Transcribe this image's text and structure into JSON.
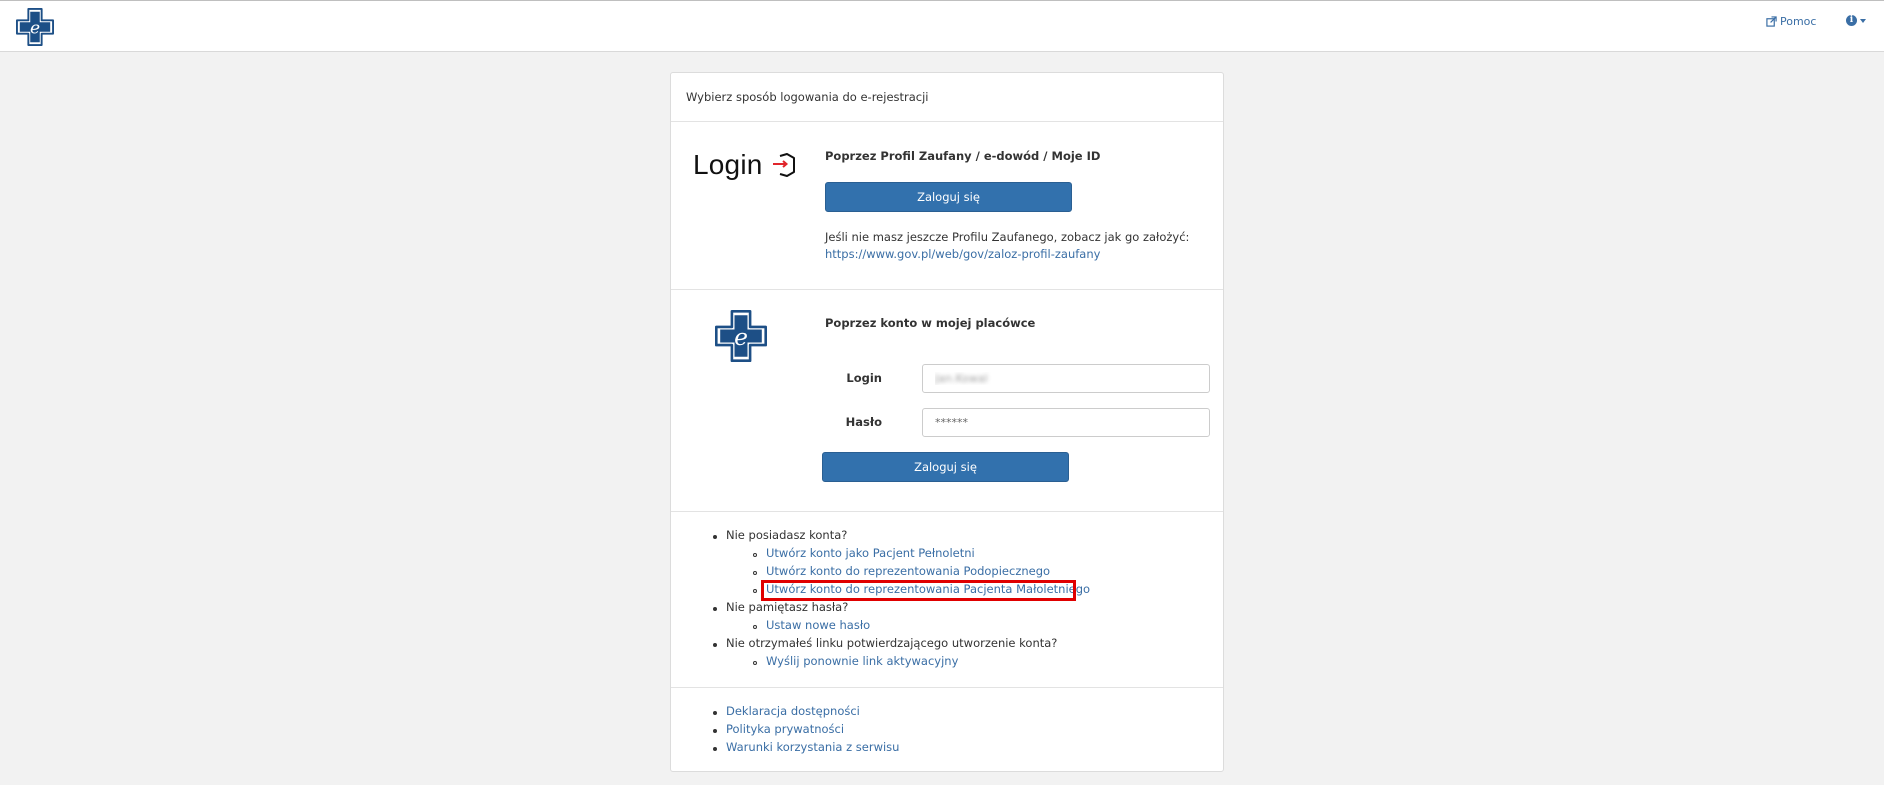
{
  "navbar": {
    "logo_icon": "e-rejestracja-cross-logo-icon",
    "help_label": "Pomoc",
    "help_icon": "external-link-icon",
    "info_icon": "info-circle-icon",
    "caret_icon": "caret-down-icon"
  },
  "panel": {
    "heading": "Wybierz sposób logowania do e-rejestracji",
    "profile_section": {
      "logo_text": "Login",
      "logo_icon": "login-arrow-icon",
      "title": "Poprzez Profil Zaufany / e-dowód / Moje ID",
      "button_label": "Zaloguj się",
      "info_text": "Jeśli nie masz jeszcze Profilu Zaufanego, zobacz jak go założyć:",
      "info_link": "https://www.gov.pl/web/gov/zaloz-profil-zaufany"
    },
    "account_section": {
      "logo_icon": "e-rejestracja-cross-logo-icon",
      "title": "Poprzez konto w mojej placówce",
      "login_label": "Login",
      "login_value": "Jan.Kowal",
      "password_label": "Hasło",
      "password_value": "******",
      "button_label": "Zaloguj się"
    },
    "help_links": {
      "no_account": "Nie posiadasz konta?",
      "create_adult": "Utwórz konto jako Pacjent Pełnoletni",
      "create_ward": "Utwórz konto do reprezentowania Podopiecznego",
      "create_minor": "Utwórz konto do reprezentowania Pacjenta Małoletniego",
      "forgot_password": "Nie pamiętasz hasła?",
      "set_new_password": "Ustaw nowe hasło",
      "no_link": "Nie otrzymałeś linku potwierdzającego utworzenie konta?",
      "resend_link": "Wyślij ponownie link aktywacyjny"
    },
    "footer_links": [
      "Deklaracja dostępności",
      "Polityka prywatności",
      "Warunki korzystania z serwisu"
    ]
  },
  "colors": {
    "primary": "#3271ad",
    "link": "#3a6ea5",
    "highlight": "#e00000",
    "page_bg": "#f2f2f2"
  }
}
